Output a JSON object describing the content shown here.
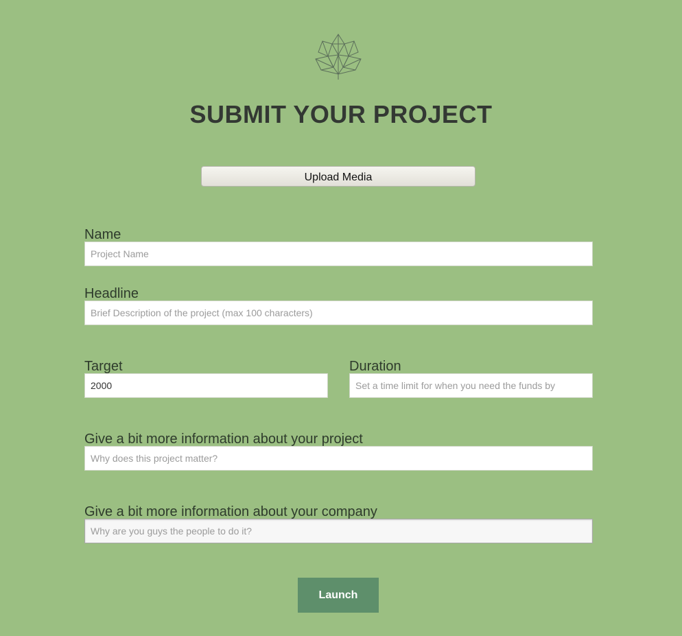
{
  "header": {
    "logo_icon": "geometric-maple-leaf-icon",
    "title": "SUBMIT YOUR PROJECT"
  },
  "upload": {
    "label": "Upload Media"
  },
  "form": {
    "name": {
      "label": "Name",
      "value": "",
      "placeholder": "Project Name"
    },
    "headline": {
      "label": "Headline",
      "value": "",
      "placeholder": "Brief Description of the project (max 100 characters)"
    },
    "target": {
      "label": "Target",
      "value": "2000",
      "placeholder": ""
    },
    "duration": {
      "label": "Duration",
      "value": "",
      "placeholder": "Set a time limit for when you need the funds by"
    },
    "project_info": {
      "label": "Give a bit more information about your project",
      "value": "",
      "placeholder": "Why does this project matter?"
    },
    "company_info": {
      "label": "Give a bit more information about your company",
      "value": "",
      "placeholder": "Why are you guys the people to do it?"
    }
  },
  "launch": {
    "label": "Launch"
  },
  "colors": {
    "background": "#9bbf82",
    "launch_button": "#5e8f6b",
    "title_text": "#333833"
  }
}
